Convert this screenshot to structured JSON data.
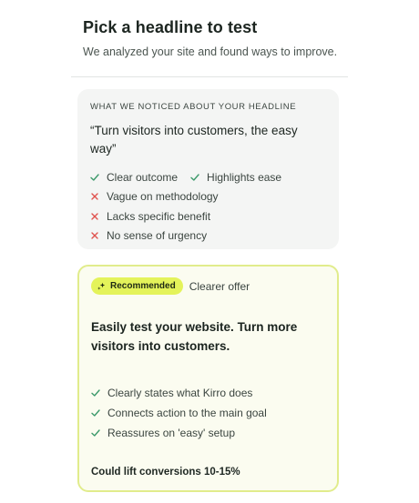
{
  "header": {
    "title": "Pick a headline to test",
    "subtitle": "We analyzed your site and found ways to improve."
  },
  "notice": {
    "label": "WHAT WE NOTICED ABOUT YOUR HEADLINE",
    "headline": "“Turn visitors into customers, the easy way”",
    "positives": [
      {
        "text": "Clear outcome",
        "icon": "check-icon"
      },
      {
        "text": "Highlights ease",
        "icon": "check-icon"
      }
    ],
    "negatives": [
      {
        "text": "Vague on methodology",
        "icon": "x-icon"
      },
      {
        "text": "Lacks specific benefit",
        "icon": "x-icon"
      },
      {
        "text": "No sense of urgency",
        "icon": "x-icon"
      }
    ]
  },
  "recommendation": {
    "badge": "Recommended",
    "badge_icon": "sparkle-icon",
    "tag": "Clearer offer",
    "headline": "Easily test your website. Turn more visitors into customers.",
    "points": [
      {
        "text": "Clearly states what Kirro does",
        "icon": "check-icon"
      },
      {
        "text": "Connects action to the main goal",
        "icon": "check-icon"
      },
      {
        "text": "Reassures on 'easy' setup",
        "icon": "check-icon"
      }
    ],
    "lift": "Could lift conversions 10-15%"
  },
  "colors": {
    "check": "#3d9a6b",
    "cross": "#e0534e",
    "badge_bg": "#e4f35a",
    "card_border": "#e1ec8c"
  }
}
